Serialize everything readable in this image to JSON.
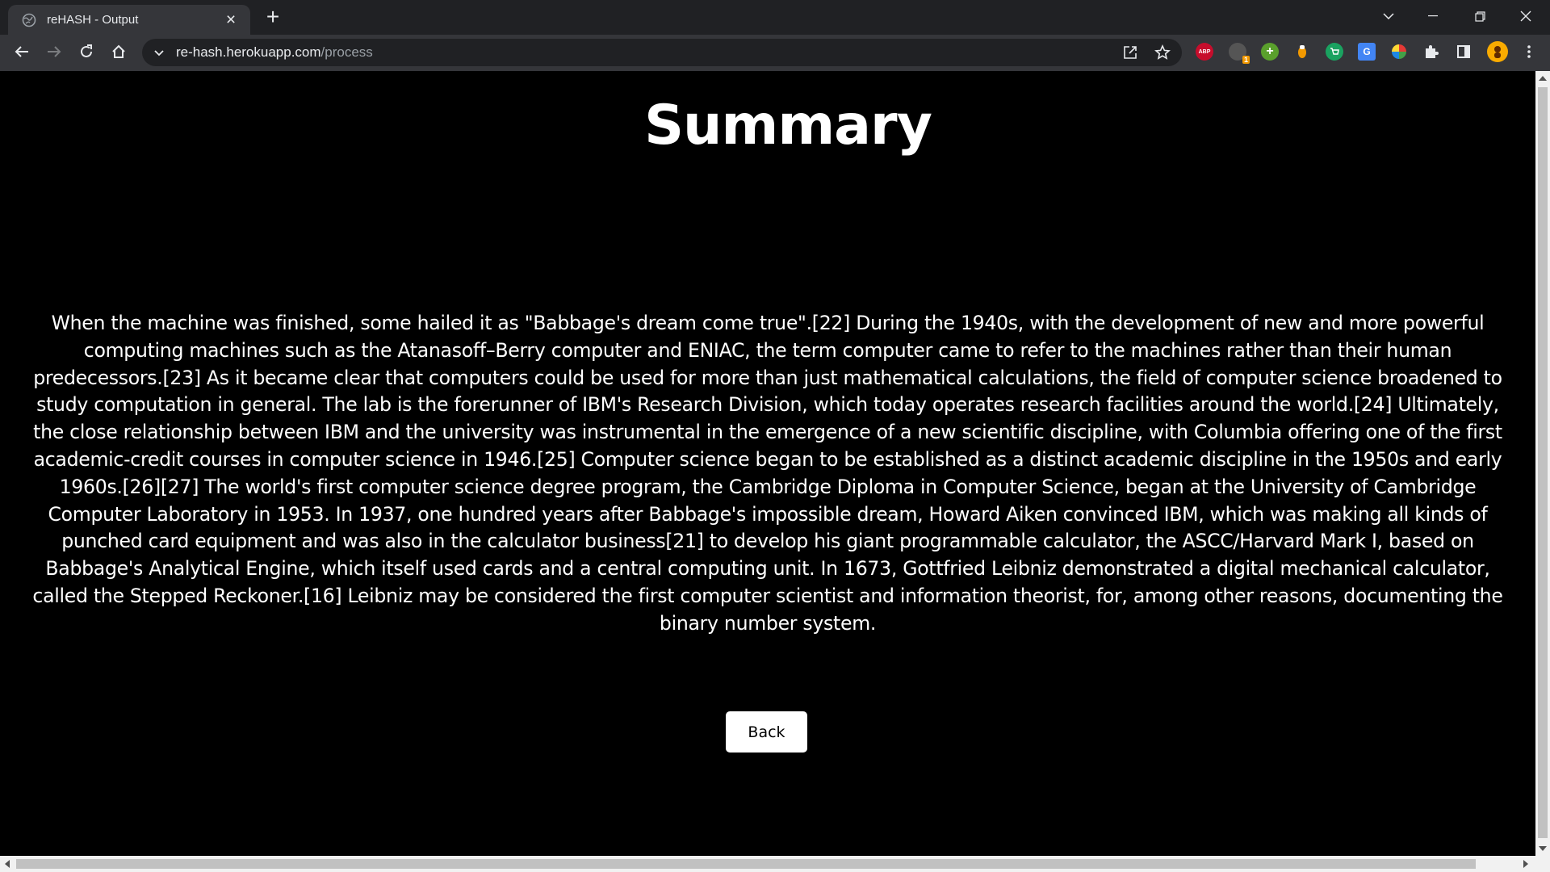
{
  "browser": {
    "tab_title": "reHASH - Output",
    "url_host": "re-hash.herokuapp.com",
    "url_path": "/process",
    "extensions": [
      {
        "name": "adblock-plus",
        "label": "ABP",
        "color": "#c70d2c"
      },
      {
        "name": "tampermonkey",
        "label": "1",
        "color": "#6b6b6b"
      },
      {
        "name": "green-plus",
        "label": "+",
        "color": "#5aa02c"
      },
      {
        "name": "orange-dot",
        "label": "",
        "color": "#f29900"
      },
      {
        "name": "shop",
        "label": "",
        "color": "#1aa260"
      },
      {
        "name": "google-translate",
        "label": "G",
        "color": "#4285f4"
      },
      {
        "name": "color-picker",
        "label": "",
        "color": "#e53935"
      }
    ]
  },
  "page": {
    "title": "Summary",
    "summary_text": "When the machine was finished, some hailed it as \"Babbage's dream come true\".[22] During the 1940s, with the development of new and more powerful computing machines such as the Atanasoff–Berry computer and ENIAC, the term computer came to refer to the machines rather than their human predecessors.[23] As it became clear that computers could be used for more than just mathematical calculations, the field of computer science broadened to study computation in general. The lab is the forerunner of IBM's Research Division, which today operates research facilities around the world.[24] Ultimately, the close relationship between IBM and the university was instrumental in the emergence of a new scientific discipline, with Columbia offering one of the first academic-credit courses in computer science in 1946.[25] Computer science began to be established as a distinct academic discipline in the 1950s and early 1960s.[26][27] The world's first computer science degree program, the Cambridge Diploma in Computer Science, began at the University of Cambridge Computer Laboratory in 1953. In 1937, one hundred years after Babbage's impossible dream, Howard Aiken convinced IBM, which was making all kinds of punched card equipment and was also in the calculator business[21] to develop his giant programmable calculator, the ASCC/Harvard Mark I, based on Babbage's Analytical Engine, which itself used cards and a central computing unit. In 1673, Gottfried Leibniz demonstrated a digital mechanical calculator, called the Stepped Reckoner.[16] Leibniz may be considered the first computer scientist and information theorist, for, among other reasons, documenting the binary number system.",
    "back_label": "Back"
  },
  "colors": {
    "page_background": "#000000",
    "text": "#ffffff",
    "button_background": "#ffffff",
    "chrome_dark": "#202124",
    "chrome_toolbar": "#35363a"
  }
}
